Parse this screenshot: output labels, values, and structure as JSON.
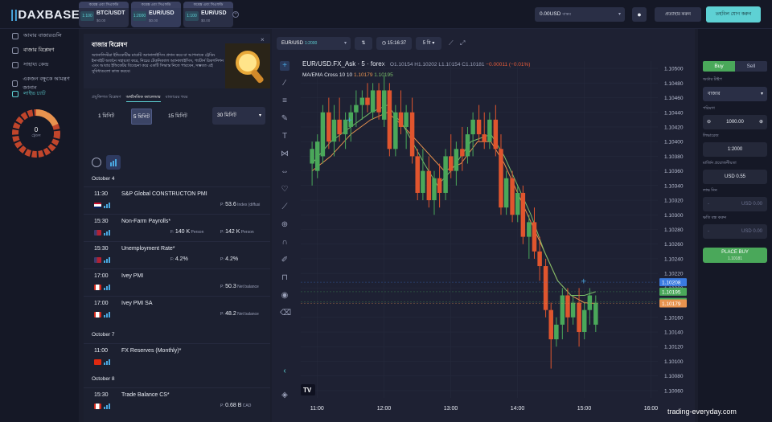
{
  "logo": {
    "prefix": "||",
    "dax": "DAX",
    "base": "BASE"
  },
  "pair_tabs": [
    {
      "header": "কমেক্স এবং সিএফডি",
      "payout": "1:100",
      "name": "BTC/USDT",
      "sub": "$0.00"
    },
    {
      "header": "কমেক্স এবং সিএফডি",
      "payout": "1:2000",
      "name": "EUR/USD",
      "sub": "$0.00"
    },
    {
      "header": "কমেক্স এবং সিএফডি",
      "payout": "1:100",
      "name": "EUR/USD",
      "sub": "$0.00"
    }
  ],
  "top": {
    "balance": "0.00USD",
    "balance_sub": "বাস্তব",
    "withdraw": "প্রত্যাহার করুন",
    "deposit": "তহবিল যোগ করুন"
  },
  "nav": [
    {
      "label": "আমার বাজারগুলি"
    },
    {
      "label": "বাজার বিশ্লেষণ"
    },
    {
      "label": "সাহায্য কেন্দ্র"
    },
    {
      "label": "একজন বন্ধুকে আমন্ত্রণ জানান"
    },
    {
      "label": "লাইভ চ্যাট"
    }
  ],
  "donut": {
    "value": "0",
    "sub": "ট্রেডস"
  },
  "panel": {
    "title": "বাজার বিশ্লেষণ",
    "description": "অ্যানালিস্টরা ইন্ডিকেটিভ মার্কেট অ্যানালাইসিস প্রদান করে যা আপনাকে ট্রেডিং ইনসাইট অর্জনে সহায়তা করে, নিচের টেকনিক্যাল অ্যানালাইসিস, প্যাটার্ন রিকগনিশন এবং আবার ইন্ডিকেটর বিবেচনা করে একটি সিদ্ধান্ত নিতে পারবেন, সম্ভবত এই সুবিধাগুলো কাজ করবে।",
    "tabs": [
      "প্রযুক্তিগত বিশ্লেষণ",
      "অর্থনৈতিক ক্যালেন্ডার",
      "বাজারের খবর"
    ],
    "timeframes": [
      "1 মিনিট",
      "5 মিনিট",
      "15 মিনিট"
    ],
    "tf_drop": "30 মিনিট"
  },
  "days": [
    "October 4",
    "October 7",
    "October 8"
  ],
  "events": [
    {
      "time": "11:30",
      "name": "S&P Global CONSTRUCTON PMI",
      "prev_label": "P:",
      "prev": "53.6",
      "prev_unit": "Index (diffusi"
    },
    {
      "time": "15:30",
      "name": "Non-Farm Payrolls*",
      "fore_label": "F:",
      "fore": "140 K",
      "fore_unit": "Person",
      "prev_label": "P:",
      "prev": "142 K",
      "prev_unit": "Person"
    },
    {
      "time": "15:30",
      "name": "Unemployment Rate*",
      "fore_label": "F:",
      "fore": "4.2%",
      "prev_label": "P:",
      "prev": "4.2%"
    },
    {
      "time": "17:00",
      "name": "Ivey PMI",
      "prev_label": "P:",
      "prev": "50.3",
      "prev_unit": "Net balance"
    },
    {
      "time": "17:00",
      "name": "Ivey PMI SA",
      "prev_label": "P:",
      "prev": "48.2",
      "prev_unit": "Net balance"
    },
    {
      "time": "11:00",
      "name": "FX Reserves (Monthly)*"
    },
    {
      "time": "15:30",
      "name": "Trade Balance CS*",
      "prev_label": "P:",
      "prev": "0.68 B",
      "prev_unit": "CAD"
    }
  ],
  "chart_toolbar": {
    "pair": "EUR/USD",
    "pair_pay": "1:2000",
    "time": "15:16:37",
    "tf": "5 মি"
  },
  "chart_legend": {
    "symbol": "EUR/USD.FX_Ask · 5 · forex",
    "o_label": "O",
    "o": "1.10154",
    "h_label": "H",
    "h": "1.10202",
    "l_label": "L",
    "l": "1.10154",
    "c_label": "C",
    "c": "1.10181",
    "change": "−0.00011 (−0.01%)",
    "ma": "MA/EMA Cross 10 10",
    "ma1": "1.10179",
    "ma2": "1.10195"
  },
  "chart_data": {
    "type": "candlestick",
    "ylim": [
      1.1005,
      1.1051
    ],
    "yticks": [
      "1.10500",
      "1.10480",
      "1.10460",
      "1.10440",
      "1.10420",
      "1.10400",
      "1.10380",
      "1.10360",
      "1.10340",
      "1.10320",
      "1.10300",
      "1.10280",
      "1.10260",
      "1.10240",
      "1.10220",
      "1.10200",
      "1.10180",
      "1.10160",
      "1.10140",
      "1.10120",
      "1.10100",
      "1.10080",
      "1.10060"
    ],
    "xticks": [
      "11:00",
      "12:00",
      "13:00",
      "14:00",
      "15:00",
      "16:00"
    ],
    "price_labels": [
      {
        "value": "1.10208",
        "color": "#3a7be0"
      },
      {
        "value": "1.10195",
        "color": "#4aa85a"
      },
      {
        "value": "1.10181",
        "color": "#4aa85a"
      },
      {
        "value": "1.10179",
        "color": "#e8934f"
      }
    ],
    "candles": [
      {
        "t": 10.92,
        "o": 1.1037,
        "h": 1.104,
        "l": 1.1034,
        "c": 1.1039
      },
      {
        "t": 11.0,
        "o": 1.1036,
        "h": 1.1041,
        "l": 1.1035,
        "c": 1.104
      },
      {
        "t": 11.08,
        "o": 1.1038,
        "h": 1.1045,
        "l": 1.1037,
        "c": 1.1044
      },
      {
        "t": 11.17,
        "o": 1.1044,
        "h": 1.1046,
        "l": 1.1039,
        "c": 1.104
      },
      {
        "t": 11.25,
        "o": 1.104,
        "h": 1.1045,
        "l": 1.1038,
        "c": 1.1043
      },
      {
        "t": 11.33,
        "o": 1.1043,
        "h": 1.1046,
        "l": 1.104,
        "c": 1.1041
      },
      {
        "t": 11.42,
        "o": 1.1041,
        "h": 1.1044,
        "l": 1.1039,
        "c": 1.1043
      },
      {
        "t": 11.5,
        "o": 1.1042,
        "h": 1.1045,
        "l": 1.104,
        "c": 1.1044
      },
      {
        "t": 11.58,
        "o": 1.1044,
        "h": 1.1047,
        "l": 1.1042,
        "c": 1.1045
      },
      {
        "t": 11.67,
        "o": 1.1045,
        "h": 1.1047,
        "l": 1.1043,
        "c": 1.1046
      },
      {
        "t": 11.75,
        "o": 1.1046,
        "h": 1.1048,
        "l": 1.1044,
        "c": 1.1045
      },
      {
        "t": 11.83,
        "o": 1.1044,
        "h": 1.1048,
        "l": 1.1043,
        "c": 1.1047
      },
      {
        "t": 11.92,
        "o": 1.1047,
        "h": 1.1048,
        "l": 1.1043,
        "c": 1.1044
      },
      {
        "t": 12.0,
        "o": 1.1043,
        "h": 1.1049,
        "l": 1.1042,
        "c": 1.1047
      },
      {
        "t": 12.08,
        "o": 1.1047,
        "h": 1.1048,
        "l": 1.1038,
        "c": 1.1039
      },
      {
        "t": 12.17,
        "o": 1.1039,
        "h": 1.1045,
        "l": 1.1038,
        "c": 1.1044
      },
      {
        "t": 12.25,
        "o": 1.1044,
        "h": 1.1047,
        "l": 1.1041,
        "c": 1.1042
      },
      {
        "t": 12.33,
        "o": 1.1042,
        "h": 1.1045,
        "l": 1.1039,
        "c": 1.1044
      },
      {
        "t": 12.42,
        "o": 1.1044,
        "h": 1.1046,
        "l": 1.1037,
        "c": 1.1038
      },
      {
        "t": 12.5,
        "o": 1.1038,
        "h": 1.1039,
        "l": 1.1032,
        "c": 1.1033
      },
      {
        "t": 12.58,
        "o": 1.1033,
        "h": 1.1039,
        "l": 1.1032,
        "c": 1.1036
      },
      {
        "t": 12.67,
        "o": 1.1036,
        "h": 1.1038,
        "l": 1.1031,
        "c": 1.1032
      },
      {
        "t": 12.75,
        "o": 1.1032,
        "h": 1.1036,
        "l": 1.103,
        "c": 1.1035
      },
      {
        "t": 12.83,
        "o": 1.1035,
        "h": 1.1037,
        "l": 1.1031,
        "c": 1.1033
      },
      {
        "t": 12.92,
        "o": 1.1033,
        "h": 1.1039,
        "l": 1.1032,
        "c": 1.1038
      },
      {
        "t": 13.0,
        "o": 1.1038,
        "h": 1.1041,
        "l": 1.1035,
        "c": 1.1036
      },
      {
        "t": 13.08,
        "o": 1.1036,
        "h": 1.104,
        "l": 1.1034,
        "c": 1.1039
      },
      {
        "t": 13.17,
        "o": 1.1039,
        "h": 1.1042,
        "l": 1.1036,
        "c": 1.1038
      },
      {
        "t": 13.25,
        "o": 1.1038,
        "h": 1.1042,
        "l": 1.1037,
        "c": 1.1041
      },
      {
        "t": 13.33,
        "o": 1.1041,
        "h": 1.1044,
        "l": 1.1038,
        "c": 1.1043
      },
      {
        "t": 13.42,
        "o": 1.1043,
        "h": 1.1045,
        "l": 1.104,
        "c": 1.1041
      },
      {
        "t": 13.5,
        "o": 1.1041,
        "h": 1.1044,
        "l": 1.1039,
        "c": 1.104
      },
      {
        "t": 13.58,
        "o": 1.104,
        "h": 1.1044,
        "l": 1.1039,
        "c": 1.1043
      },
      {
        "t": 13.67,
        "o": 1.1043,
        "h": 1.1045,
        "l": 1.1038,
        "c": 1.1039
      },
      {
        "t": 13.75,
        "o": 1.1039,
        "h": 1.1041,
        "l": 1.103,
        "c": 1.1031
      },
      {
        "t": 13.83,
        "o": 1.1031,
        "h": 1.1036,
        "l": 1.103,
        "c": 1.1035
      },
      {
        "t": 13.92,
        "o": 1.1035,
        "h": 1.1036,
        "l": 1.1029,
        "c": 1.103
      },
      {
        "t": 14.0,
        "o": 1.103,
        "h": 1.1034,
        "l": 1.1029,
        "c": 1.1033
      },
      {
        "t": 14.08,
        "o": 1.1033,
        "h": 1.1034,
        "l": 1.1026,
        "c": 1.1027
      },
      {
        "t": 14.17,
        "o": 1.1027,
        "h": 1.103,
        "l": 1.1024,
        "c": 1.1029
      },
      {
        "t": 14.25,
        "o": 1.1029,
        "h": 1.1031,
        "l": 1.1024,
        "c": 1.1025
      },
      {
        "t": 14.33,
        "o": 1.1025,
        "h": 1.1027,
        "l": 1.1021,
        "c": 1.1023
      },
      {
        "t": 14.42,
        "o": 1.1023,
        "h": 1.1024,
        "l": 1.1016,
        "c": 1.1017
      },
      {
        "t": 14.5,
        "o": 1.1017,
        "h": 1.1018,
        "l": 1.1009,
        "c": 1.1013
      },
      {
        "t": 14.58,
        "o": 1.1013,
        "h": 1.1016,
        "l": 1.1012,
        "c": 1.1015
      },
      {
        "t": 14.67,
        "o": 1.1015,
        "h": 1.102,
        "l": 1.1013,
        "c": 1.1019
      },
      {
        "t": 14.75,
        "o": 1.1019,
        "h": 1.102,
        "l": 1.1014,
        "c": 1.1016
      },
      {
        "t": 14.83,
        "o": 1.1016,
        "h": 1.1019,
        "l": 1.1015,
        "c": 1.1018
      },
      {
        "t": 14.92,
        "o": 1.1018,
        "h": 1.102,
        "l": 1.1012,
        "c": 1.1014
      },
      {
        "t": 15.0,
        "o": 1.1014,
        "h": 1.1018,
        "l": 1.1013,
        "c": 1.1017
      },
      {
        "t": 15.08,
        "o": 1.1017,
        "h": 1.102,
        "l": 1.1015,
        "c": 1.1019
      },
      {
        "t": 15.17,
        "o": 1.1015,
        "h": 1.1019,
        "l": 1.1014,
        "c": 1.1018
      }
    ],
    "ma_orange": [
      [
        10.92,
        1.1036
      ],
      [
        11.2,
        1.1038
      ],
      [
        11.5,
        1.1041
      ],
      [
        11.8,
        1.1043
      ],
      [
        12.05,
        1.1044
      ],
      [
        12.3,
        1.1042
      ],
      [
        12.6,
        1.1039
      ],
      [
        12.9,
        1.1036
      ],
      [
        13.15,
        1.1037
      ],
      [
        13.4,
        1.104
      ],
      [
        13.6,
        1.104
      ],
      [
        13.8,
        1.1037
      ],
      [
        14.0,
        1.1033
      ],
      [
        14.2,
        1.1029
      ],
      [
        14.4,
        1.1025
      ],
      [
        14.6,
        1.1021
      ],
      [
        14.8,
        1.1019
      ],
      [
        15.0,
        1.1018
      ],
      [
        15.17,
        1.10179
      ]
    ],
    "ma_green": [
      [
        10.92,
        1.1037
      ],
      [
        11.2,
        1.104
      ],
      [
        11.5,
        1.1042
      ],
      [
        11.8,
        1.1044
      ],
      [
        12.05,
        1.1045
      ],
      [
        12.3,
        1.1042
      ],
      [
        12.6,
        1.1037
      ],
      [
        12.8,
        1.1034
      ],
      [
        13.0,
        1.1036
      ],
      [
        13.3,
        1.104
      ],
      [
        13.6,
        1.1041
      ],
      [
        13.8,
        1.1038
      ],
      [
        14.0,
        1.1034
      ],
      [
        14.2,
        1.103
      ],
      [
        14.4,
        1.1025
      ],
      [
        14.6,
        1.1021
      ],
      [
        14.8,
        1.1019
      ],
      [
        15.0,
        1.1019
      ],
      [
        15.17,
        1.10195
      ]
    ]
  },
  "right": {
    "buy": "Buy",
    "sell": "Sell",
    "order_type_label": "অর্ডার টাইপ",
    "order_type": "বাজার",
    "size_label": "পরিমাণ",
    "size": "1000.00",
    "leverage_label": "লিভারেজ",
    "leverage": "1:2000",
    "margin_label": "মার্জিন প্রয়োজনীয়তা",
    "margin": "USD 0.55",
    "tp_label": "লাভ নিন",
    "tp_value": "USD 0.00",
    "sl_label": "ক্ষতি বন্ধ করুন",
    "sl_value": "USD 0.00",
    "dash": "-",
    "place_title": "PLACE BUY",
    "place_price": "1.10181"
  },
  "watermark": "trading-everyday.com"
}
